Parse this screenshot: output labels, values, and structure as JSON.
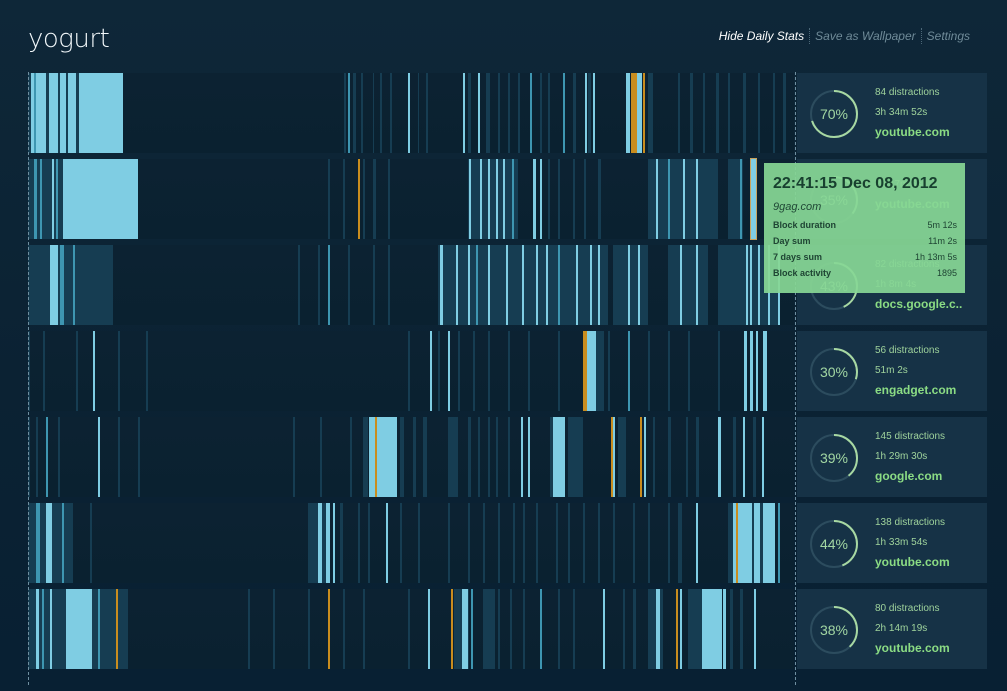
{
  "app": {
    "title": "yogurt"
  },
  "nav": {
    "hide_daily_stats": "Hide Daily Stats",
    "save_wallpaper": "Save as Wallpaper",
    "settings": "Settings"
  },
  "colors": {
    "light": "#7fcde3",
    "mid": "#3e96b1",
    "orange": "#c98d1e",
    "region": "#163d52",
    "tooltip": "#86d694"
  },
  "days": [
    {
      "stats": {
        "percent": "70%",
        "percent_value": 0.7,
        "distractions": "84 distractions",
        "duration": "3h 34m 52s",
        "site": "youtube.com"
      }
    },
    {
      "stats": {
        "percent": "35%",
        "percent_value": 0.35,
        "distractions": "",
        "duration": "2h 17m 6s",
        "site": "youtube.com"
      }
    },
    {
      "stats": {
        "percent": "43%",
        "percent_value": 0.43,
        "distractions": "82 distractions",
        "duration": "1h 8m 4s",
        "site": "docs.google.c.."
      }
    },
    {
      "stats": {
        "percent": "30%",
        "percent_value": 0.3,
        "distractions": "56 distractions",
        "duration": "51m 2s",
        "site": "engadget.com"
      }
    },
    {
      "stats": {
        "percent": "39%",
        "percent_value": 0.39,
        "distractions": "145 distractions",
        "duration": "1h 29m 30s",
        "site": "google.com"
      }
    },
    {
      "stats": {
        "percent": "44%",
        "percent_value": 0.44,
        "distractions": "138 distractions",
        "duration": "1h 33m 54s",
        "site": "youtube.com"
      }
    },
    {
      "stats": {
        "percent": "38%",
        "percent_value": 0.38,
        "distractions": "80 distractions",
        "duration": "2h 14m 19s",
        "site": "youtube.com"
      }
    }
  ],
  "tooltip": {
    "time": "22:41:15 Dec 08, 2012",
    "site": "9gag.com",
    "rows": [
      {
        "label": "Block duration",
        "value": "5m 12s"
      },
      {
        "label": "Day sum",
        "value": "11m 2s"
      },
      {
        "label": "7 days sum",
        "value": "1h 13m 5s"
      },
      {
        "label": "Block activity",
        "value": "1895"
      }
    ]
  }
}
